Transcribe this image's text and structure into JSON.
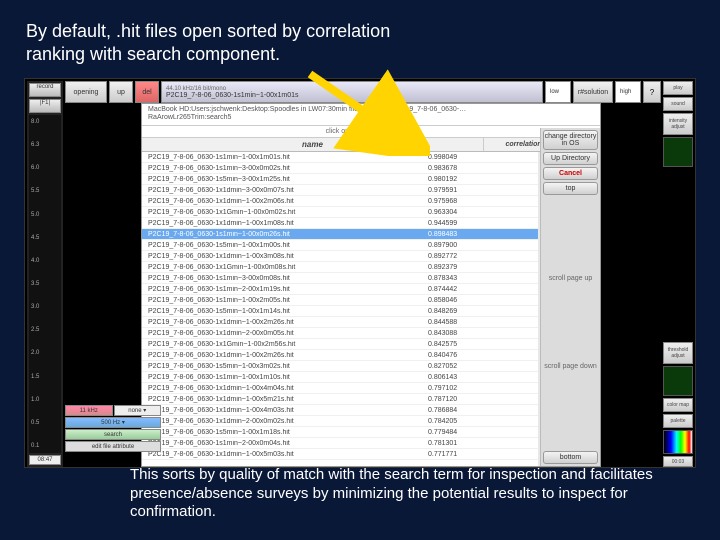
{
  "caption_top": "By default, .hit files open sorted by correlation ranking with search component.",
  "caption_bottom": "This sorts by quality of match with the search term for inspection and facilitates presence/absence surveys by minimizing the potential results to inspect for confirmation.",
  "topbar": {
    "record": "record",
    "f1": "|F1|",
    "opening": "opening",
    "up": "up",
    "del": "del",
    "title_small": "44.10 kHz/16 bit/mono",
    "title_main": "P2C19_7-8-06_0630-1s1min~1-00x1m01s",
    "low": "low",
    "res": "r#solution",
    "high": "high",
    "q": "?",
    "play": "play",
    "sound": "sound"
  },
  "leftscale": [
    "8.0",
    "6.3",
    "6.0",
    "5.5",
    "5.0",
    "4.5",
    "4.0",
    "3.5",
    "3.0",
    "2.5",
    "2.0",
    "1.5",
    "1.0",
    "0.5",
    "0.1"
  ],
  "time_left": "08:47",
  "time_right": "00:03",
  "bottomctl": {
    "khz": "11 kHz",
    "none": "none ▾",
    "hz": "500 Hz ▾",
    "search": "search",
    "attr": "edit file attribute"
  },
  "rightstrip": {
    "intensity": "intensity adjust",
    "threshold": "threshold adjust",
    "color": "color map",
    "palette": "palette"
  },
  "dialog": {
    "crumb1": "MacBook HD:Users:jschwenk:Desktop:Spoodles in LW07:30min files in P2C ▸ P2C19_7-8-06_0630-…",
    "crumb2": "RaArowLr265Trim:search5",
    "hint": "click once on a file to select it",
    "col_name": "name",
    "col_coef": "correlation coefficient",
    "changedir": "change directory in OS",
    "updir": "Up Directory",
    "cancel": "Cancel",
    "top": "top",
    "scroll_up": "scroll page up",
    "scroll_down": "scroll page down",
    "bottom": "bottom",
    "selected_index": 7,
    "rows": [
      {
        "fn": "P2C19_7-8-06_0630-1s1min~1-00x1m01s.hit",
        "cc": "0.998049"
      },
      {
        "fn": "P2C19_7-8-06_0630-1s1min~3-00x0m02s.hit",
        "cc": "0.983678"
      },
      {
        "fn": "P2C19_7-8-06_0630-1s5min~3-00x1m25s.hit",
        "cc": "0.980192"
      },
      {
        "fn": "P2C19_7-8-06_0630-1x1dmin~3-00x0m07s.hit",
        "cc": "0.979591"
      },
      {
        "fn": "P2C19_7-8-06_0630-1x1dmin~1-00x2m06s.hit",
        "cc": "0.975968"
      },
      {
        "fn": "P2C19_7-8-06_0630-1x1Gmin~1-00x0m02s.hit",
        "cc": "0.963304"
      },
      {
        "fn": "P2C19_7-8-06_0630-1x1dmin~1-00x1m08s.hit",
        "cc": "0.944599"
      },
      {
        "fn": "P2C19_7-8-06_0630-1s1min~1-00x0m26s.hit",
        "cc": "0.898483"
      },
      {
        "fn": "P2C19_7-8-06_0630-1s5min~1-00x1m00s.hit",
        "cc": "0.897900"
      },
      {
        "fn": "P2C19_7-8-06_0630-1x1dmin~1-00x3m08s.hit",
        "cc": "0.892772"
      },
      {
        "fn": "P2C19_7-8-06_0630-1x1Gmin~1-00x0m08s.hit",
        "cc": "0.892379"
      },
      {
        "fn": "P2C19_7-8-06_0630-1s1min~3-00x0m08s.hit",
        "cc": "0.878343"
      },
      {
        "fn": "P2C19_7-8-06_0630-1s1min~2-00x1m19s.hit",
        "cc": "0.874442"
      },
      {
        "fn": "P2C19_7-8-06_0630-1s1min~1-00x2m05s.hit",
        "cc": "0.858046"
      },
      {
        "fn": "P2C19_7-8-06_0630-1s5min~1-00x1m14s.hit",
        "cc": "0.848269"
      },
      {
        "fn": "P2C19_7-8-06_0630-1x1dmin~1-00x2m26s.hit",
        "cc": "0.844588"
      },
      {
        "fn": "P2C19_7-8-06_0630-1x1dmin~2-00x0m05s.hit",
        "cc": "0.843088"
      },
      {
        "fn": "P2C19_7-8-06_0630-1x1Gmin~1-00x2m56s.hit",
        "cc": "0.842575"
      },
      {
        "fn": "P2C19_7-8-06_0630-1x1dmin~1-00x2m26s.hit",
        "cc": "0.840476"
      },
      {
        "fn": "P2C19_7-8-06_0630-1s5min~1-00x3m02s.hit",
        "cc": "0.827052"
      },
      {
        "fn": "P2C19_7-8-06_0630-1s1min~1-00x1m10s.hit",
        "cc": "0.806143"
      },
      {
        "fn": "P2C19_7-8-06_0630-1x1dmin~1-00x4m04s.hit",
        "cc": "0.797102"
      },
      {
        "fn": "P2C19_7-8-06_0630-1x1dmin~1-00x5m21s.hit",
        "cc": "0.787120"
      },
      {
        "fn": "P2C19_7-8-06_0630-1x1dmin~1-00x4m03s.hit",
        "cc": "0.786884"
      },
      {
        "fn": "P2C19_7-8-06_0630-1x1dmin~2-00x0m02s.hit",
        "cc": "0.784205"
      },
      {
        "fn": "P2C19_7-8-06_0630-1s5min~1-00x1m18s.hit",
        "cc": "0.779484"
      },
      {
        "fn": "P2C19_7-8-06_0630-1s1min~2-00x0m04s.hit",
        "cc": "0.781301"
      },
      {
        "fn": "P2C19_7-8-06_0630-1x1dmin~1-00x5m03s.hit",
        "cc": "0.771771"
      }
    ]
  }
}
